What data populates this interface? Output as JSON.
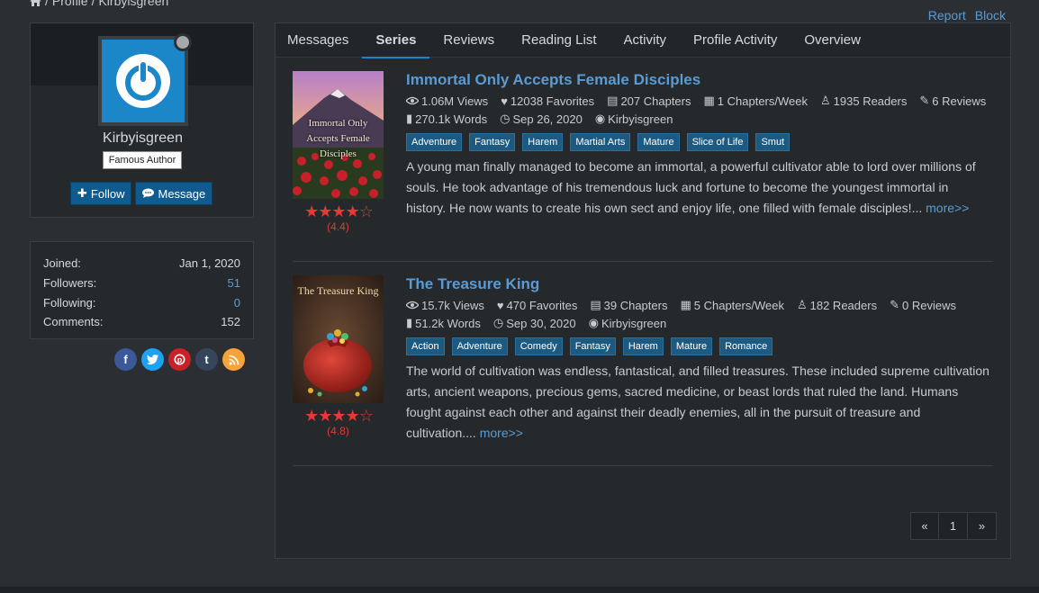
{
  "breadcrumb": {
    "home_icon": "home-icon",
    "items": [
      "Profile",
      "Kirbyisgreen"
    ],
    "sep": "/"
  },
  "top_links": {
    "report": "Report",
    "block": "Block"
  },
  "profile": {
    "username": "Kirbyisgreen",
    "badge": "Famous Author",
    "follow_label": "Follow",
    "message_label": "Message",
    "avatar_icon": "power-icon",
    "avatar_color": "#1b87c9"
  },
  "stats": [
    {
      "label": "Joined:",
      "value": "Jan 1, 2020"
    },
    {
      "label": "Followers:",
      "value": "51"
    },
    {
      "label": "Following:",
      "value": "0"
    },
    {
      "label": "Comments:",
      "value": "152"
    }
  ],
  "social": [
    "facebook-icon",
    "twitter-icon",
    "pinterest-icon",
    "tumblr-icon",
    "rss-icon"
  ],
  "tabs": [
    "Messages",
    "Series",
    "Reviews",
    "Reading List",
    "Activity",
    "Profile Activity",
    "Overview"
  ],
  "active_tab": "Series",
  "series": [
    {
      "title": "Immortal Only Accepts Female Disciples",
      "cover_text": "Immortal Only Accepts Female Disciples",
      "views": "1.06M Views",
      "favorites": "12038 Favorites",
      "chapters": "207 Chapters",
      "per_week": "1 Chapters/Week",
      "readers": "1935 Readers",
      "reviews": "6 Reviews",
      "words": "270.1k Words",
      "date": "Sep 26, 2020",
      "author": "Kirbyisgreen",
      "tags": [
        "Adventure",
        "Fantasy",
        "Harem",
        "Martial Arts",
        "Mature",
        "Slice of Life",
        "Smut"
      ],
      "description": "A young man finally managed to become an immortal, a powerful cultivator able to lord over millions of souls. He took advantage of his tremendous luck and fortune to become the youngest immortal in history. He now wants to create his own sect and enjoy life, one filled with female disciples!...",
      "more": "more>>",
      "rating": "(4.4)",
      "stars": "★★★★☆"
    },
    {
      "title": "The Treasure King",
      "cover_text": "The Treasure King",
      "views": "15.7k Views",
      "favorites": "470 Favorites",
      "chapters": "39 Chapters",
      "per_week": "5 Chapters/Week",
      "readers": "182 Readers",
      "reviews": "0 Reviews",
      "words": "51.2k Words",
      "date": "Sep 30, 2020",
      "author": "Kirbyisgreen",
      "tags": [
        "Action",
        "Adventure",
        "Comedy",
        "Fantasy",
        "Harem",
        "Mature",
        "Romance"
      ],
      "description": "The world of cultivation was endless, fantastical, and filled treasures. These included supreme cultivation arts, ancient weapons, precious gems, sacred medicine, or beast lords that ruled the land. Humans fought against each other and against their deadly enemies, all in the pursuit of treasure and cultivation....",
      "more": "more>>",
      "rating": "(4.8)",
      "stars": "★★★★☆"
    }
  ],
  "pagination": {
    "prev": "«",
    "page": "1",
    "next": "»"
  }
}
